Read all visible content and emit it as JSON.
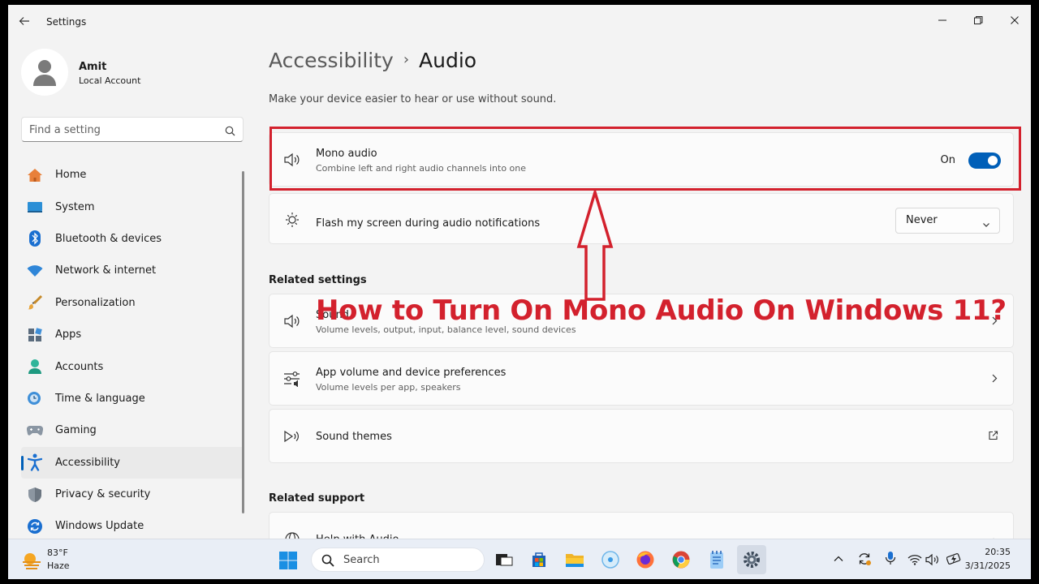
{
  "window": {
    "title": "Settings",
    "controls": [
      "minimize",
      "maximize",
      "close"
    ]
  },
  "profile": {
    "name": "Amit",
    "account_type": "Local Account"
  },
  "search": {
    "placeholder": "Find a setting"
  },
  "sidebar": {
    "items": [
      {
        "label": "Home",
        "icon": "home-icon"
      },
      {
        "label": "System",
        "icon": "system-icon"
      },
      {
        "label": "Bluetooth & devices",
        "icon": "bluetooth-icon"
      },
      {
        "label": "Network & internet",
        "icon": "wifi-icon"
      },
      {
        "label": "Personalization",
        "icon": "brush-icon"
      },
      {
        "label": "Apps",
        "icon": "apps-icon"
      },
      {
        "label": "Accounts",
        "icon": "accounts-icon"
      },
      {
        "label": "Time & language",
        "icon": "clock-globe-icon"
      },
      {
        "label": "Gaming",
        "icon": "gamepad-icon"
      },
      {
        "label": "Accessibility",
        "icon": "accessibility-icon",
        "active": true
      },
      {
        "label": "Privacy & security",
        "icon": "shield-icon"
      },
      {
        "label": "Windows Update",
        "icon": "update-icon"
      }
    ]
  },
  "breadcrumb": {
    "parent": "Accessibility",
    "separator": "›",
    "current": "Audio"
  },
  "subtitle": "Make your device easier to hear or use without sound.",
  "settings": {
    "mono_audio": {
      "title": "Mono audio",
      "description": "Combine left and right audio channels into one",
      "state_label": "On",
      "enabled": true
    },
    "flash_screen": {
      "title": "Flash my screen during audio notifications",
      "value": "Never"
    }
  },
  "related_settings": {
    "heading": "Related settings",
    "items": [
      {
        "title": "Sound",
        "description": "Volume levels, output, input, balance level, sound devices"
      },
      {
        "title": "App volume and device preferences",
        "description": "Volume levels per app, speakers"
      },
      {
        "title": "Sound themes",
        "description": ""
      }
    ]
  },
  "related_support": {
    "heading": "Related support",
    "items": [
      {
        "title": "Help with Audio"
      }
    ]
  },
  "overlay": {
    "caption": "How to Turn On Mono Audio On Windows 11?",
    "color": "#d3212d"
  },
  "taskbar": {
    "weather_temp": "83°F",
    "weather_desc": "Haze",
    "search_label": "Search",
    "time": "20:35",
    "date": "3/31/2025"
  },
  "colors": {
    "accent": "#005fb8",
    "highlight": "#d3212d"
  }
}
